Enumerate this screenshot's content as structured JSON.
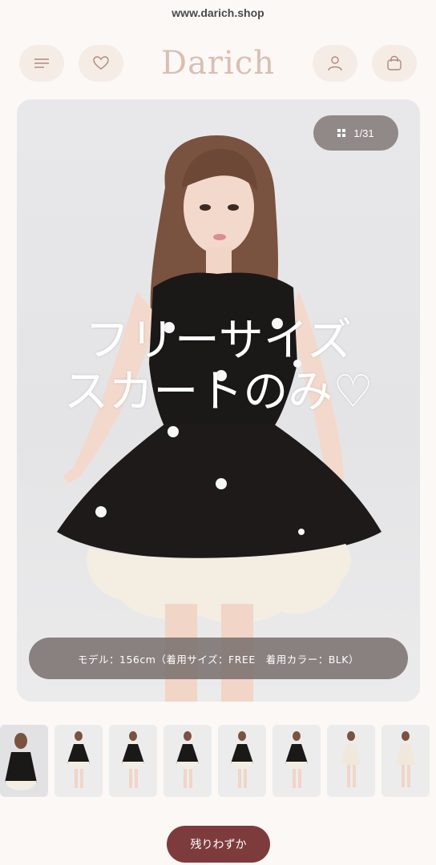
{
  "browser": {
    "url": "www.darich.shop"
  },
  "header": {
    "logo": "Darich",
    "icons": [
      "menu-icon",
      "heart-icon",
      "user-icon",
      "bag-icon"
    ]
  },
  "gallery": {
    "counter": "1/31",
    "overlay_lines": [
      "フリーサイズ",
      "スカートのみ♡"
    ],
    "model_info": "モデル：156cm（着用サイズ：FREE　着用カラー：BLK）",
    "thumbnail_count": 8
  },
  "cta": {
    "label": "残りわずか"
  },
  "colors": {
    "background": "#fbf8f6",
    "logo": "#d9bfb2",
    "cta": "#7d3b3c",
    "icon_button_bg": "#f5ece6"
  }
}
